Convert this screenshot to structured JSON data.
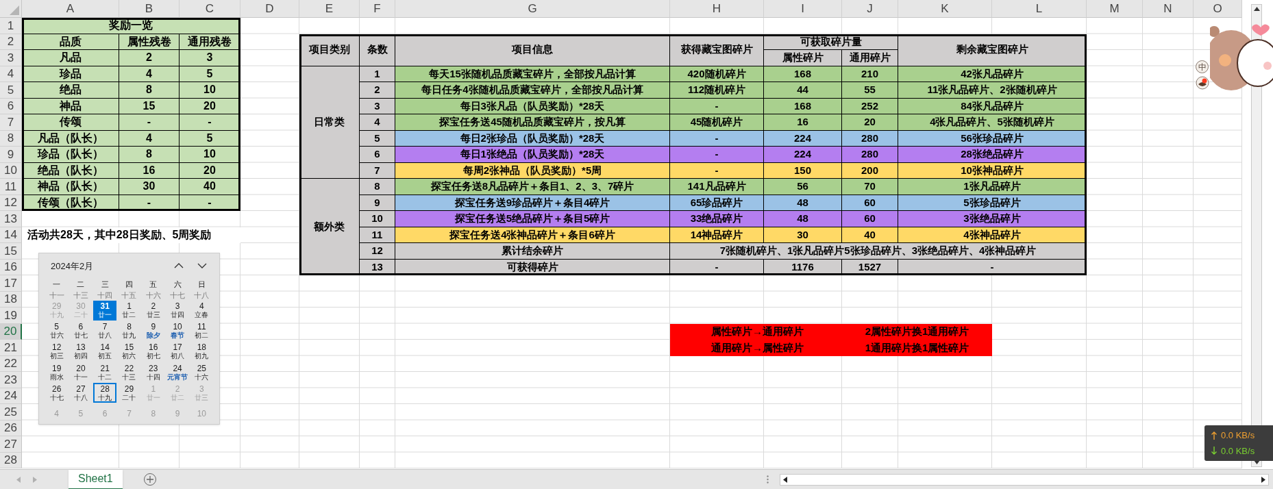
{
  "columns": [
    {
      "label": "A",
      "selected": false
    },
    {
      "label": "B",
      "selected": false
    },
    {
      "label": "C",
      "selected": false
    },
    {
      "label": "D",
      "selected": false
    },
    {
      "label": "E",
      "selected": false
    },
    {
      "label": "F",
      "selected": false
    },
    {
      "label": "G",
      "selected": false
    },
    {
      "label": "H",
      "selected": false
    },
    {
      "label": "I",
      "selected": false
    },
    {
      "label": "J",
      "selected": false
    },
    {
      "label": "K",
      "selected": false
    },
    {
      "label": "L",
      "selected": false
    },
    {
      "label": "M",
      "selected": false
    },
    {
      "label": "N",
      "selected": false
    },
    {
      "label": "O",
      "selected": false
    }
  ],
  "rows": [
    {
      "label": "1",
      "selected": false
    },
    {
      "label": "2",
      "selected": false
    },
    {
      "label": "3",
      "selected": false
    },
    {
      "label": "4",
      "selected": false
    },
    {
      "label": "5",
      "selected": false
    },
    {
      "label": "6",
      "selected": false
    },
    {
      "label": "7",
      "selected": false
    },
    {
      "label": "8",
      "selected": false
    },
    {
      "label": "9",
      "selected": false
    },
    {
      "label": "10",
      "selected": false
    },
    {
      "label": "11",
      "selected": false
    },
    {
      "label": "12",
      "selected": false
    },
    {
      "label": "13",
      "selected": false
    },
    {
      "label": "14",
      "selected": false
    },
    {
      "label": "15",
      "selected": false
    },
    {
      "label": "16",
      "selected": false
    },
    {
      "label": "17",
      "selected": false
    },
    {
      "label": "18",
      "selected": false
    },
    {
      "label": "19",
      "selected": false
    },
    {
      "label": "20",
      "selected": true
    },
    {
      "label": "21",
      "selected": false
    },
    {
      "label": "22",
      "selected": false
    },
    {
      "label": "23",
      "selected": false
    },
    {
      "label": "24",
      "selected": false
    },
    {
      "label": "25",
      "selected": false
    },
    {
      "label": "26",
      "selected": false
    },
    {
      "label": "27",
      "selected": false
    },
    {
      "label": "28",
      "selected": false
    }
  ],
  "reward_table": {
    "title": "奖励一览",
    "headers": [
      "品质",
      "属性残卷",
      "通用残卷"
    ],
    "rows": [
      {
        "quality": "凡品",
        "attr": "2",
        "general": "3"
      },
      {
        "quality": "珍品",
        "attr": "4",
        "general": "5"
      },
      {
        "quality": "绝品",
        "attr": "8",
        "general": "10"
      },
      {
        "quality": "神品",
        "attr": "15",
        "general": "20"
      },
      {
        "quality": "传颂",
        "attr": "-",
        "general": "-"
      },
      {
        "quality": "凡品（队长）",
        "attr": "4",
        "general": "5"
      },
      {
        "quality": "珍品（队长）",
        "attr": "8",
        "general": "10"
      },
      {
        "quality": "绝品（队长）",
        "attr": "16",
        "general": "20"
      },
      {
        "quality": "神品（队长）",
        "attr": "30",
        "general": "40"
      },
      {
        "quality": "传颂（队长）",
        "attr": "-",
        "general": "-"
      }
    ]
  },
  "note": "活动共28天，其中28日奖励、5周奖励",
  "main_table": {
    "headers": {
      "category": "项目类别",
      "no": "条数",
      "info": "项目信息",
      "obtained": "获得藏宝图碎片",
      "available": "可获取碎片量",
      "attr": "属性碎片",
      "general": "通用碎片",
      "remaining": "剩余藏宝图碎片"
    },
    "groups": [
      {
        "label": "日常类",
        "rows": [
          {
            "kind": "detail",
            "no": "1",
            "info": "每天15张随机品质藏宝碎片，全部按凡品计算",
            "obtained": "420随机碎片",
            "attr": "168",
            "general": "210",
            "remaining": "42张凡品碎片",
            "color": "#a9d08e"
          },
          {
            "kind": "detail",
            "no": "2",
            "info": "每日任务4张随机品质藏宝碎片，全部按凡品计算",
            "obtained": "112随机碎片",
            "attr": "44",
            "general": "55",
            "remaining": "11张凡品碎片、2张随机碎片",
            "color": "#a9d08e"
          },
          {
            "kind": "detail",
            "no": "3",
            "info": "每日3张凡品（队员奖励）*28天",
            "obtained": "-",
            "attr": "168",
            "general": "252",
            "remaining": "84张凡品碎片",
            "color": "#a9d08e"
          },
          {
            "kind": "detail",
            "no": "4",
            "info": "探宝任务送45随机品质藏宝碎片，按凡算",
            "obtained": "45随机碎片",
            "attr": "16",
            "general": "20",
            "remaining": "4张凡品碎片、5张随机碎片",
            "color": "#a9d08e"
          },
          {
            "kind": "detail",
            "no": "5",
            "info": "每日2张珍品（队员奖励）*28天",
            "obtained": "-",
            "attr": "224",
            "general": "280",
            "remaining": "56张珍品碎片",
            "color": "#9bc2e6"
          },
          {
            "kind": "detail",
            "no": "6",
            "info": "每日1张绝品（队员奖励）*28天",
            "obtained": "-",
            "attr": "224",
            "general": "280",
            "remaining": "28张绝品碎片",
            "color": "#b47ef0"
          },
          {
            "kind": "detail",
            "no": "7",
            "info": "每周2张神品（队员奖励）*5周",
            "obtained": "-",
            "attr": "150",
            "general": "200",
            "remaining": "10张神品碎片",
            "color": "#ffd966"
          }
        ]
      },
      {
        "label": "额外类",
        "rows": [
          {
            "kind": "detail",
            "no": "8",
            "info": "探宝任务送8凡品碎片＋条目1、2、3、7碎片",
            "obtained": "141凡品碎片",
            "attr": "56",
            "general": "70",
            "remaining": "1张凡品碎片",
            "color": "#a9d08e"
          },
          {
            "kind": "detail",
            "no": "9",
            "info": "探宝任务送9珍品碎片＋条目4碎片",
            "obtained": "65珍品碎片",
            "attr": "48",
            "general": "60",
            "remaining": "5张珍品碎片",
            "color": "#9bc2e6"
          },
          {
            "kind": "detail",
            "no": "10",
            "info": "探宝任务送5绝品碎片＋条目5碎片",
            "obtained": "33绝品碎片",
            "attr": "48",
            "general": "60",
            "remaining": "3张绝品碎片",
            "color": "#b47ef0"
          },
          {
            "kind": "detail",
            "no": "11",
            "info": "探宝任务送4张神品碎片＋条目6碎片",
            "obtained": "14神品碎片",
            "attr": "30",
            "general": "40",
            "remaining": "4张神品碎片",
            "color": "#ffd966"
          },
          {
            "kind": "merged",
            "no": "12",
            "info": "累计结余碎片",
            "merged_text": "7张随机碎片、1张凡品碎片5张珍品碎片、3张绝品碎片、4张神品碎片",
            "color": "#d0cece"
          },
          {
            "kind": "detail",
            "no": "13",
            "info": "可获得碎片",
            "obtained": "-",
            "attr": "1176",
            "general": "1527",
            "remaining": "-",
            "color": "#d0cece"
          }
        ]
      }
    ]
  },
  "conversion": [
    {
      "from": "属性碎片→通用碎片",
      "rate": "2属性碎片换1通用碎片"
    },
    {
      "from": "通用碎片→属性碎片",
      "rate": "1通用碎片换1属性碎片"
    }
  ],
  "calendar": {
    "title": "2024年2月",
    "weekdays": [
      "一",
      "二",
      "三",
      "四",
      "五",
      "六",
      "日"
    ],
    "prev_lunar": [
      "十一",
      "十三",
      "十四",
      "十五",
      "十六",
      "十七",
      "十八"
    ],
    "weeks": [
      [
        {
          "day": "29",
          "lunar": "十九",
          "muted": true,
          "selected": false,
          "outlined": false,
          "festival": false
        },
        {
          "day": "30",
          "lunar": "二十",
          "muted": true,
          "selected": false,
          "outlined": false,
          "festival": false
        },
        {
          "day": "31",
          "lunar": "廿一",
          "muted": false,
          "selected": true,
          "outlined": false,
          "festival": false
        },
        {
          "day": "1",
          "lunar": "廿二",
          "muted": false,
          "selected": false,
          "outlined": false,
          "festival": false
        },
        {
          "day": "2",
          "lunar": "廿三",
          "muted": false,
          "selected": false,
          "outlined": false,
          "festival": false
        },
        {
          "day": "3",
          "lunar": "廿四",
          "muted": false,
          "selected": false,
          "outlined": false,
          "festival": false
        },
        {
          "day": "4",
          "lunar": "立春",
          "muted": false,
          "selected": false,
          "outlined": false,
          "festival": false
        }
      ],
      [
        {
          "day": "5",
          "lunar": "廿六",
          "muted": false,
          "selected": false,
          "outlined": false,
          "festival": false
        },
        {
          "day": "6",
          "lunar": "廿七",
          "muted": false,
          "selected": false,
          "outlined": false,
          "festival": false
        },
        {
          "day": "7",
          "lunar": "廿八",
          "muted": false,
          "selected": false,
          "outlined": false,
          "festival": false
        },
        {
          "day": "8",
          "lunar": "廿九",
          "muted": false,
          "selected": false,
          "outlined": false,
          "festival": false
        },
        {
          "day": "9",
          "lunar": "除夕",
          "muted": false,
          "selected": false,
          "outlined": false,
          "festival": true
        },
        {
          "day": "10",
          "lunar": "春节",
          "muted": false,
          "selected": false,
          "outlined": false,
          "festival": true
        },
        {
          "day": "11",
          "lunar": "初二",
          "muted": false,
          "selected": false,
          "outlined": false,
          "festival": false
        }
      ],
      [
        {
          "day": "12",
          "lunar": "初三",
          "muted": false,
          "selected": false,
          "outlined": false,
          "festival": false
        },
        {
          "day": "13",
          "lunar": "初四",
          "muted": false,
          "selected": false,
          "outlined": false,
          "festival": false
        },
        {
          "day": "14",
          "lunar": "初五",
          "muted": false,
          "selected": false,
          "outlined": false,
          "festival": false
        },
        {
          "day": "15",
          "lunar": "初六",
          "muted": false,
          "selected": false,
          "outlined": false,
          "festival": false
        },
        {
          "day": "16",
          "lunar": "初七",
          "muted": false,
          "selected": false,
          "outlined": false,
          "festival": false
        },
        {
          "day": "17",
          "lunar": "初八",
          "muted": false,
          "selected": false,
          "outlined": false,
          "festival": false
        },
        {
          "day": "18",
          "lunar": "初九",
          "muted": false,
          "selected": false,
          "outlined": false,
          "festival": false
        }
      ],
      [
        {
          "day": "19",
          "lunar": "雨水",
          "muted": false,
          "selected": false,
          "outlined": false,
          "festival": false
        },
        {
          "day": "20",
          "lunar": "十一",
          "muted": false,
          "selected": false,
          "outlined": false,
          "festival": false
        },
        {
          "day": "21",
          "lunar": "十二",
          "muted": false,
          "selected": false,
          "outlined": false,
          "festival": false
        },
        {
          "day": "22",
          "lunar": "十三",
          "muted": false,
          "selected": false,
          "outlined": false,
          "festival": false
        },
        {
          "day": "23",
          "lunar": "十四",
          "muted": false,
          "selected": false,
          "outlined": false,
          "festival": false
        },
        {
          "day": "24",
          "lunar": "元宵节",
          "muted": false,
          "selected": false,
          "outlined": false,
          "festival": true
        },
        {
          "day": "25",
          "lunar": "十六",
          "muted": false,
          "selected": false,
          "outlined": false,
          "festival": false
        }
      ],
      [
        {
          "day": "26",
          "lunar": "十七",
          "muted": false,
          "selected": false,
          "outlined": false,
          "festival": false
        },
        {
          "day": "27",
          "lunar": "十八",
          "muted": false,
          "selected": false,
          "outlined": false,
          "festival": false
        },
        {
          "day": "28",
          "lunar": "十九",
          "muted": false,
          "selected": false,
          "outlined": true,
          "festival": false
        },
        {
          "day": "29",
          "lunar": "二十",
          "muted": false,
          "selected": false,
          "outlined": false,
          "festival": false
        },
        {
          "day": "1",
          "lunar": "廿一",
          "muted": true,
          "selected": false,
          "outlined": false,
          "festival": false
        },
        {
          "day": "2",
          "lunar": "廿二",
          "muted": true,
          "selected": false,
          "outlined": false,
          "festival": false
        },
        {
          "day": "3",
          "lunar": "廿三",
          "muted": true,
          "selected": false,
          "outlined": false,
          "festival": false
        }
      ],
      [
        {
          "day": "4",
          "muted": true,
          "selected": false,
          "outlined": false
        },
        {
          "day": "5",
          "muted": true,
          "selected": false,
          "outlined": false
        },
        {
          "day": "6",
          "muted": true,
          "selected": false,
          "outlined": false
        },
        {
          "day": "7",
          "muted": true,
          "selected": false,
          "outlined": false
        },
        {
          "day": "8",
          "muted": true,
          "selected": false,
          "outlined": false
        },
        {
          "day": "9",
          "muted": true,
          "selected": false,
          "outlined": false
        },
        {
          "day": "10",
          "muted": true,
          "selected": false,
          "outlined": false
        }
      ]
    ]
  },
  "sheet_tabs": [
    {
      "label": "Sheet1",
      "selected": true
    }
  ],
  "net_speed": {
    "upload": "0.0 KB/s",
    "download": "0.0 KB/s"
  },
  "ime": "中"
}
